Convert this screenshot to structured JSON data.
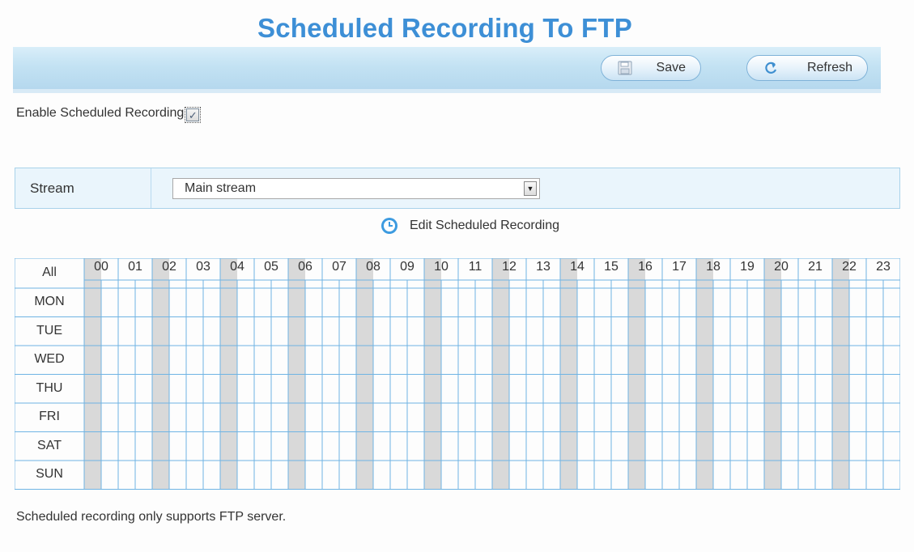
{
  "page": {
    "title": "Scheduled Recording To FTP"
  },
  "toolbar": {
    "save_label": "Save",
    "refresh_label": "Refresh"
  },
  "enable": {
    "label": "Enable Scheduled Recording",
    "checked": true,
    "check_mark": "✓"
  },
  "stream": {
    "label": "Stream",
    "selected": "Main stream"
  },
  "edit": {
    "label": "Edit Scheduled Recording"
  },
  "schedule": {
    "all_label": "All",
    "hours": [
      "00",
      "01",
      "02",
      "03",
      "04",
      "05",
      "06",
      "07",
      "08",
      "09",
      "10",
      "11",
      "12",
      "13",
      "14",
      "15",
      "16",
      "17",
      "18",
      "19",
      "20",
      "21",
      "22",
      "23"
    ],
    "days": [
      "MON",
      "TUE",
      "WED",
      "THU",
      "FRI",
      "SAT",
      "SUN"
    ]
  },
  "note": {
    "text": "Scheduled recording only supports FTP server."
  },
  "colors": {
    "title": "#3d8fd6",
    "grid_line": "#6fb4e4",
    "shaded_column": "#d9d9d9",
    "panel_bg": "#eaf5fc"
  }
}
